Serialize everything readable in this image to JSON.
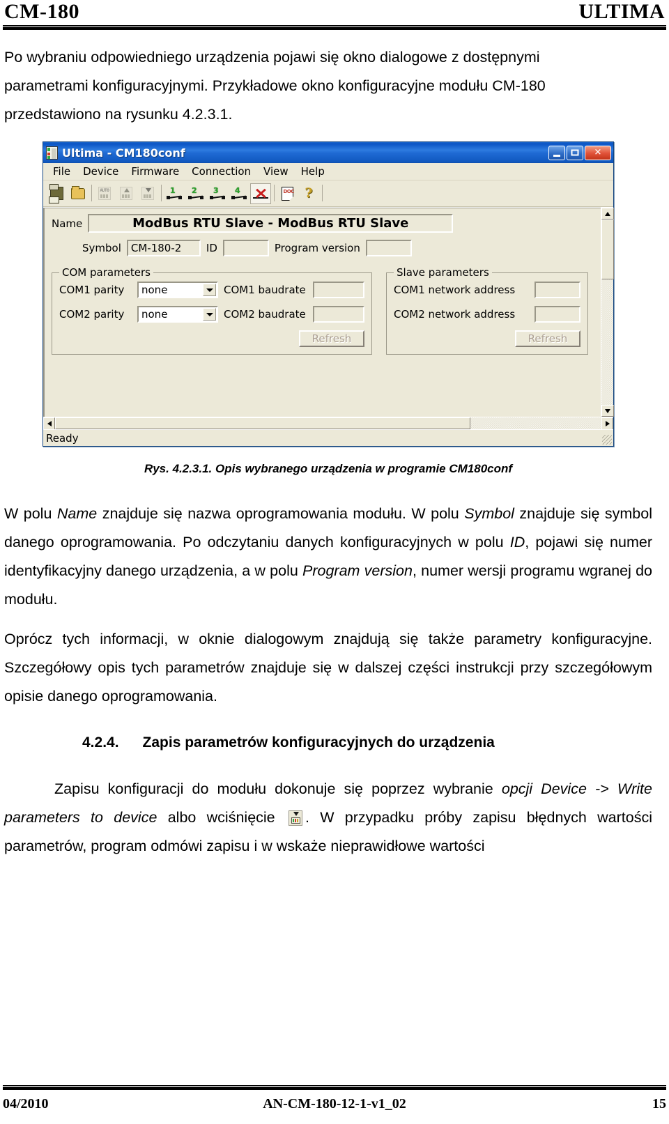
{
  "header": {
    "left": "CM-180",
    "right": "ULTIMA"
  },
  "intro": {
    "line1": "Po wybraniu odpowiedniego urządzenia pojawi się okno dialogowe z dostępnymi",
    "line2": "parametrami konfiguracyjnymi. Przykładowe okno konfiguracyjne modułu CM-180",
    "line3": "przedstawiono  na rysunku  4.2.3.1."
  },
  "app": {
    "title": "Ultima - CM180conf",
    "icon": "device-module-icon",
    "window_buttons": {
      "minimize": "minimize-button",
      "maximize": "maximize-button",
      "close": "close-button"
    },
    "menu": [
      "File",
      "Device",
      "Firmware",
      "Connection",
      "View",
      "Help"
    ],
    "toolbar": [
      {
        "name": "save-icon",
        "kind": "floppy",
        "enabled": true
      },
      {
        "name": "open-icon",
        "kind": "folder",
        "enabled": true
      },
      {
        "name": "auto-detect-icon",
        "kind": "module",
        "label": "AUTO",
        "enabled": false
      },
      {
        "name": "read-parameters-from-device-icon",
        "kind": "module-up",
        "enabled": false
      },
      {
        "name": "write-parameters-to-device-icon",
        "kind": "module-down",
        "enabled": false
      },
      {
        "name": "connection-1-icon",
        "kind": "conn",
        "label": "1",
        "enabled": true
      },
      {
        "name": "connection-2-icon",
        "kind": "conn",
        "label": "2",
        "enabled": true
      },
      {
        "name": "connection-3-icon",
        "kind": "conn",
        "label": "3",
        "enabled": true
      },
      {
        "name": "connection-4-icon",
        "kind": "conn",
        "label": "4",
        "enabled": true
      },
      {
        "name": "disconnect-icon",
        "kind": "disconnect",
        "enabled": true
      },
      {
        "name": "documentation-icon",
        "kind": "doc",
        "label": "DOC",
        "enabled": true
      },
      {
        "name": "help-icon",
        "kind": "help",
        "label": "?",
        "enabled": true
      }
    ],
    "form": {
      "name_label": "Name",
      "name_value": "ModBus RTU Slave - ModBus RTU Slave",
      "symbol_label": "Symbol",
      "symbol_value": "CM-180-2",
      "id_label": "ID",
      "id_value": "",
      "program_version_label": "Program version",
      "program_version_value": ""
    },
    "com_group": {
      "legend": "COM parameters",
      "com1_parity_label": "COM1 parity",
      "com1_parity_value": "none",
      "com1_baudrate_label": "COM1 baudrate",
      "com1_baudrate_value": "",
      "com2_parity_label": "COM2 parity",
      "com2_parity_value": "none",
      "com2_baudrate_label": "COM2 baudrate",
      "com2_baudrate_value": "",
      "refresh_label": "Refresh"
    },
    "slave_group": {
      "legend": "Slave parameters",
      "com1_addr_label": "COM1 network address",
      "com1_addr_value": "",
      "com2_addr_label": "COM2 network address",
      "com2_addr_value": "",
      "refresh_label": "Refresh"
    },
    "status": "Ready"
  },
  "figure": {
    "caption": "Rys. 4.2.3.1. Opis wybranego urządzenia w programie CM180conf"
  },
  "body": {
    "p1_a": "W polu ",
    "p1_name": "Name",
    "p1_b": " znajduje się nazwa oprogramowania modułu. W polu ",
    "p1_symbol": "Symbol",
    "p1_c": " znajduje się symbol danego oprogramowania. Po odczytaniu danych konfiguracyjnych w polu ",
    "p1_id": "ID",
    "p1_d": ", pojawi się numer identyfikacyjny danego urządzenia, a w polu ",
    "p1_pver": "Program version",
    "p1_e": ", numer wersji programu wgranej do modułu.",
    "p2": "Oprócz tych informacji, w oknie dialogowym znajdują się także parametry konfiguracyjne. Szczegółowy opis tych parametrów znajduje się w dalszej części instrukcji przy szczegółowym opisie danego oprogramowania."
  },
  "section": {
    "number": "4.2.4.",
    "title": "Zapis parametrów konfiguracyjnych do urządzenia",
    "p_a": "Zapisu konfiguracji do modułu dokonuje się poprzez wybranie ",
    "p_opt": "opcji Device -> Write parameters to device",
    "p_b": " albo wciśnięcie ",
    "p_icon": "write-parameters-icon",
    "p_c": ". W przypadku próby zapisu błędnych wartości parametrów, program odmówi zapisu i w wskaże nieprawidłowe wartości"
  },
  "footer": {
    "left": "04/2010",
    "center": "AN-CM-180-12-1-v1_02",
    "right": "15"
  }
}
